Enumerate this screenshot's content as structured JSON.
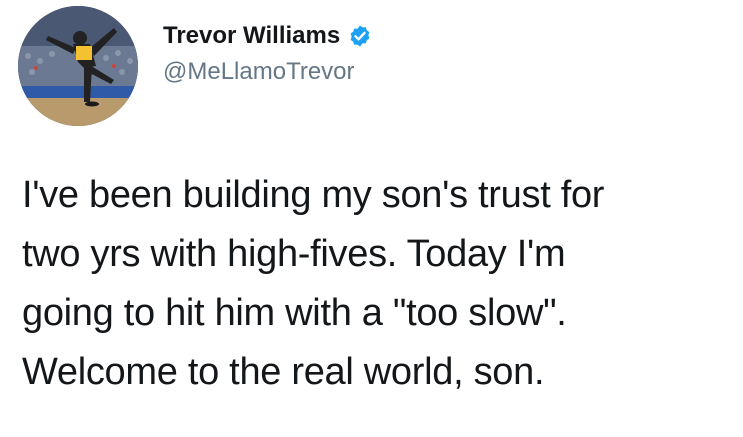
{
  "author": {
    "display_name": "Trevor Williams",
    "handle": "@MeLlamoTrevor",
    "verified": true,
    "avatar_icon": "profile-photo-baseball-pitcher"
  },
  "tweet": {
    "lines": [
      "I've been building my son's trust for",
      "two yrs with high-fives. Today I'm",
      "going to hit him with a \"too slow\".",
      "Welcome to the real world, son."
    ]
  },
  "colors": {
    "text": "#14171a",
    "handle": "#657786",
    "verified_badge": "#1da1f2"
  }
}
